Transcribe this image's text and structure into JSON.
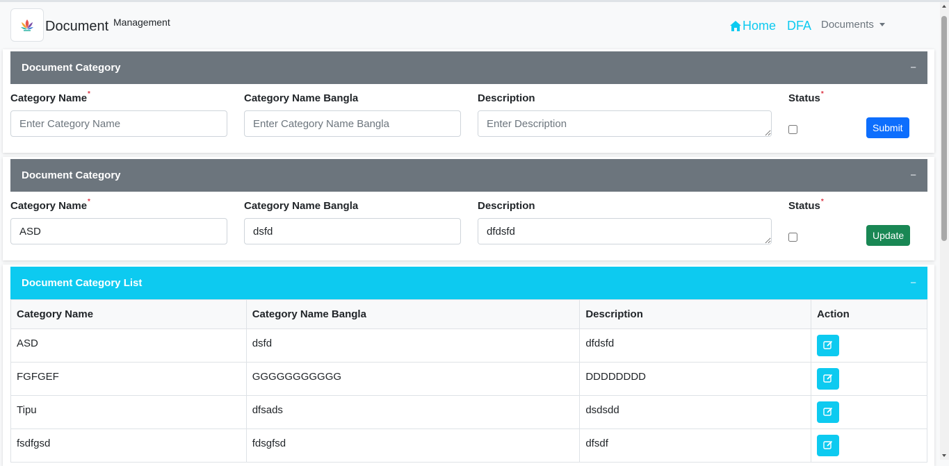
{
  "brand": {
    "main": "Document",
    "sup": "Management"
  },
  "nav": {
    "home": "Home",
    "dfa": "DFA",
    "documents": "Documents"
  },
  "create_form": {
    "title": "Document Category",
    "collapse": "−",
    "labels": {
      "name": "Category Name",
      "bangla": "Category Name Bangla",
      "description": "Description",
      "status": "Status"
    },
    "required_mark": "*",
    "placeholders": {
      "name": "Enter Category Name",
      "bangla": "Enter Category Name Bangla",
      "description": "Enter Description"
    },
    "status_checked": false,
    "submit_label": "Submit"
  },
  "edit_form": {
    "title": "Document Category",
    "collapse": "−",
    "labels": {
      "name": "Category Name",
      "bangla": "Category Name Bangla",
      "description": "Description",
      "status": "Status"
    },
    "required_mark": "*",
    "values": {
      "name": "ASD",
      "bangla": "dsfd",
      "description": "dfdsfd"
    },
    "status_checked": false,
    "update_label": "Update"
  },
  "list": {
    "title": "Document Category List",
    "collapse": "−",
    "columns": [
      "Category Name",
      "Category Name Bangla",
      "Description",
      "Action"
    ],
    "rows": [
      {
        "name": "ASD",
        "bangla": "dsfd",
        "description": "dfdsfd"
      },
      {
        "name": "FGFGEF",
        "bangla": "GGGGGGGGGGG",
        "description": "DDDDDDDD"
      },
      {
        "name": "Tipu",
        "bangla": "dfsads",
        "description": "dsdsdd"
      },
      {
        "name": "fsdfgsd",
        "bangla": "fdsgfsd",
        "description": "dfsdf"
      }
    ],
    "action_icon": "edit-icon"
  },
  "colors": {
    "primary": "#0d6efd",
    "success": "#198754",
    "info": "#0dcaf0",
    "secondary": "#6c757d",
    "danger": "#dc3545"
  }
}
